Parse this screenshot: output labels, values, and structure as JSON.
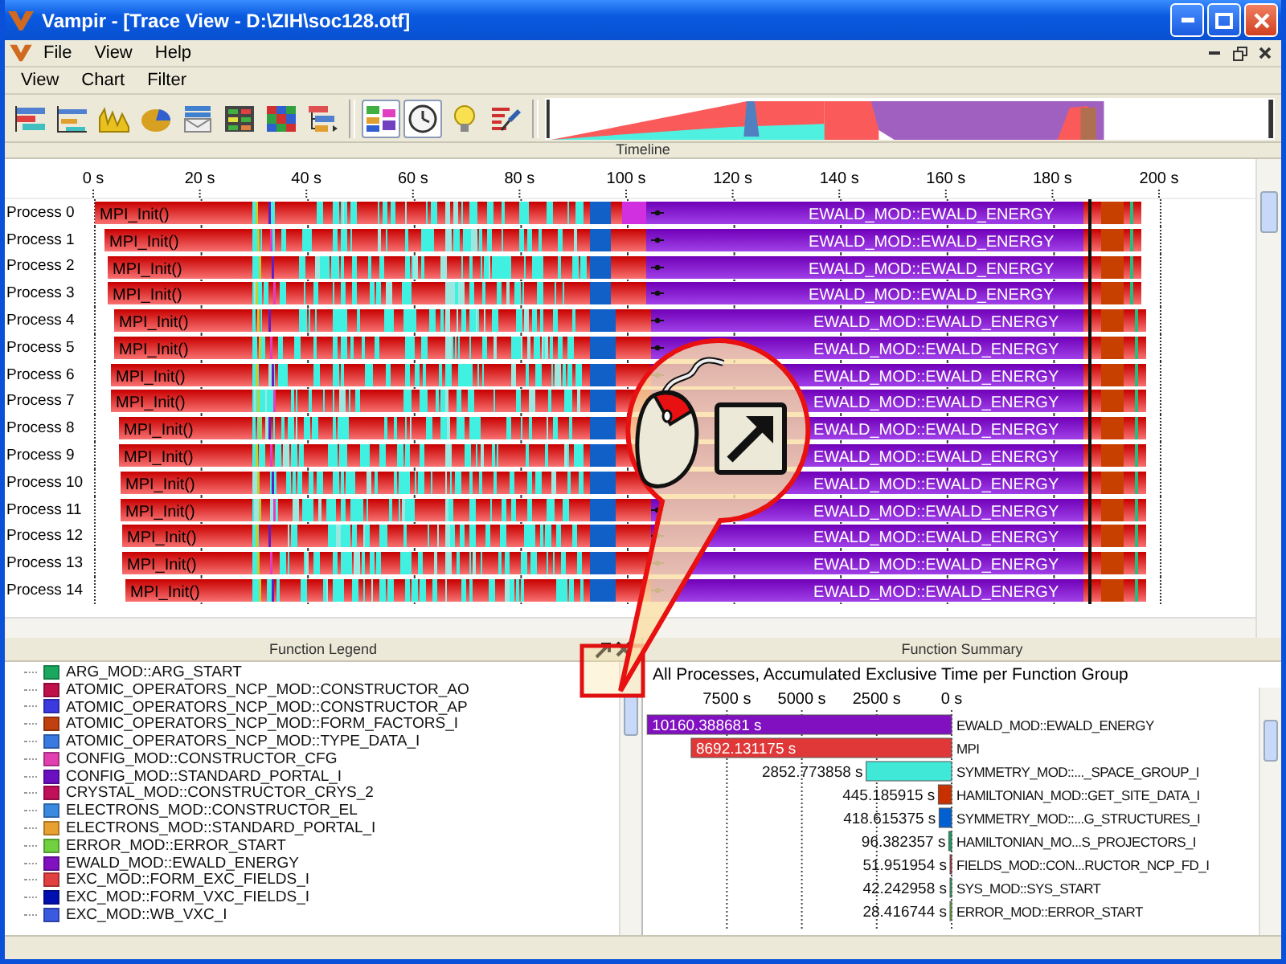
{
  "window": {
    "title": "Vampir - [Trace View - D:\\ZIH\\soc128.otf]"
  },
  "menubar": [
    "File",
    "View",
    "Help"
  ],
  "chart_menubar": [
    "View",
    "Chart",
    "Filter"
  ],
  "toolbar": [
    {
      "kind": "timeline",
      "pressed": false
    },
    {
      "kind": "process-timeline",
      "pressed": false
    },
    {
      "kind": "counter",
      "pressed": false
    },
    {
      "kind": "pie",
      "pressed": false
    },
    {
      "kind": "message",
      "pressed": false
    },
    {
      "kind": "matrix",
      "pressed": false
    },
    {
      "kind": "grid",
      "pressed": false
    },
    {
      "kind": "call-tree",
      "pressed": false
    },
    {
      "kind": "function-group",
      "pressed": true
    },
    {
      "kind": "clock",
      "pressed": true
    },
    {
      "kind": "bulb",
      "pressed": false
    },
    {
      "kind": "pin",
      "pressed": false
    }
  ],
  "timeline": {
    "title": "Timeline",
    "ticks": [
      "0 s",
      "20 s",
      "40 s",
      "60 s",
      "80 s",
      "100 s",
      "120 s",
      "140 s",
      "160 s",
      "180 s",
      "200 s"
    ],
    "processes": [
      {
        "name": "Process 0",
        "first_function": "MPI_Init()",
        "main_function": "EWALD_MOD::EWALD_ENERGY"
      },
      {
        "name": "Process 1",
        "first_function": "MPI_Init()",
        "main_function": "EWALD_MOD::EWALD_ENERGY"
      },
      {
        "name": "Process 2",
        "first_function": "MPI_Init()",
        "main_function": "EWALD_MOD::EWALD_ENERGY"
      },
      {
        "name": "Process 3",
        "first_function": "MPI_Init()",
        "main_function": "EWALD_MOD::EWALD_ENERGY"
      },
      {
        "name": "Process 4",
        "first_function": "MPI_Init()",
        "main_function": "EWALD_MOD::EWALD_ENERGY"
      },
      {
        "name": "Process 5",
        "first_function": "MPI_Init()",
        "main_function": "EWALD_MOD::EWALD_ENERGY"
      },
      {
        "name": "Process 6",
        "first_function": "MPI_Init()",
        "main_function": "EWALD_MOD::EWALD_ENERGY"
      },
      {
        "name": "Process 7",
        "first_function": "MPI_Init()",
        "main_function": "EWALD_MOD::EWALD_ENERGY"
      },
      {
        "name": "Process 8",
        "first_function": "MPI_Init()",
        "main_function": "EWALD_MOD::EWALD_ENERGY"
      },
      {
        "name": "Process 9",
        "first_function": "MPI_Init()",
        "main_function": "EWALD_MOD::EWALD_ENERGY"
      },
      {
        "name": "Process 10",
        "first_function": "MPI_Init()",
        "main_function": "EWALD_MOD::EWALD_ENERGY"
      },
      {
        "name": "Process 11",
        "first_function": "MPI_Init()",
        "main_function": "EWALD_MOD::EWALD_ENERGY"
      },
      {
        "name": "Process 12",
        "first_function": "MPI_Init()",
        "main_function": "EWALD_MOD::EWALD_ENERGY"
      },
      {
        "name": "Process 13",
        "first_function": "MPI_Init()",
        "main_function": "EWALD_MOD::EWALD_ENERGY"
      },
      {
        "name": "Process 14",
        "first_function": "MPI_Init()",
        "main_function": "EWALD_MOD::EWALD_ENERGY"
      }
    ]
  },
  "function_legend": {
    "title": "Function Legend",
    "items": [
      {
        "name": "ARG_MOD::ARG_START",
        "color": "#1aa860"
      },
      {
        "name": "ATOMIC_OPERATORS_NCP_MOD::CONSTRUCTOR_AO",
        "color": "#c0104a"
      },
      {
        "name": "ATOMIC_OPERATORS_NCP_MOD::CONSTRUCTOR_AP",
        "color": "#3a3ae0"
      },
      {
        "name": "ATOMIC_OPERATORS_NCP_MOD::FORM_FACTORS_I",
        "color": "#c04010"
      },
      {
        "name": "ATOMIC_OPERATORS_NCP_MOD::TYPE_DATA_I",
        "color": "#3a7ae0"
      },
      {
        "name": "CONFIG_MOD::CONSTRUCTOR_CFG",
        "color": "#e040b0"
      },
      {
        "name": "CONFIG_MOD::STANDARD_PORTAL_I",
        "color": "#6a10c0"
      },
      {
        "name": "CRYSTAL_MOD::CONSTRUCTOR_CRYS_2",
        "color": "#c0105a"
      },
      {
        "name": "ELECTRONS_MOD::CONSTRUCTOR_EL",
        "color": "#3a8ae0"
      },
      {
        "name": "ELECTRONS_MOD::STANDARD_PORTAL_I",
        "color": "#e8a030"
      },
      {
        "name": "ERROR_MOD::ERROR_START",
        "color": "#70d040"
      },
      {
        "name": "EWALD_MOD::EWALD_ENERGY",
        "color": "#8010c0"
      },
      {
        "name": "EXC_MOD::FORM_EXC_FIELDS_I",
        "color": "#e04040"
      },
      {
        "name": "EXC_MOD::FORM_VXC_FIELDS_I",
        "color": "#0010b0"
      },
      {
        "name": "EXC_MOD::WB_VXC_I",
        "color": "#3a5ae0"
      }
    ]
  },
  "function_summary": {
    "title": "Function Summary",
    "subtitle": "All Processes, Accumulated Exclusive Time per Function Group",
    "chart_data": {
      "type": "bar",
      "orientation": "horizontal",
      "xlim": [
        10300,
        0
      ],
      "grid": true,
      "categories": [
        "EWALD_MOD::EWALD_ENERGY",
        "MPI",
        "SYMMETRY_MOD::..._SPACE_GROUP_I",
        "HAMILTONIAN_MOD::GET_SITE_DATA_I",
        "SYMMETRY_MOD::...G_STRUCTURES_I",
        "HAMILTONIAN_MO...S_PROJECTORS_I",
        "FIELDS_MOD::CON...RUCTOR_NCP_FD_I",
        "SYS_MOD::SYS_START",
        "ERROR_MOD::ERROR_START"
      ],
      "values": [
        10160.388681,
        8692.131175,
        2852.773858,
        445.185915,
        418.615375,
        96.382357,
        51.951954,
        42.242958,
        28.416744
      ],
      "colors": [
        "#8010c0",
        "#e03838",
        "#40e8d8",
        "#c83000",
        "#0060d0",
        "#10a060",
        "#c02020",
        "#20b060",
        "#60c030"
      ],
      "value_labels": [
        "10160.388681 s",
        "8692.131175 s",
        "2852.773858 s",
        "445.185915 s",
        "418.615375 s",
        "96.382357 s",
        "51.951954 s",
        "42.242958 s",
        "28.416744 s"
      ],
      "xticks": [
        {
          "value": 7500,
          "label": "7500 s"
        },
        {
          "value": 5000,
          "label": "5000 s"
        },
        {
          "value": 2500,
          "label": "2500 s"
        },
        {
          "value": 0,
          "label": "0 s"
        }
      ]
    }
  }
}
